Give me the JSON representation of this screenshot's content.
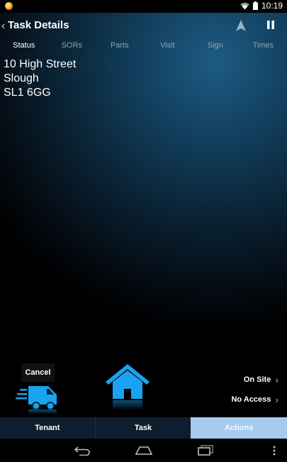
{
  "status_bar": {
    "time": "10:19"
  },
  "header": {
    "title": "Task Details"
  },
  "tabs": [
    {
      "label": "Status",
      "active": true
    },
    {
      "label": "SORs",
      "active": false
    },
    {
      "label": "Parts",
      "active": false
    },
    {
      "label": "Visit",
      "active": false
    },
    {
      "label": "Sign",
      "active": false
    },
    {
      "label": "Times",
      "active": false
    }
  ],
  "address": {
    "line1": "10 High Street",
    "line2": "Slough",
    "line3": "SL1 6GG"
  },
  "actions": {
    "cancel_tooltip": "Cancel",
    "on_site": "On Site",
    "no_access": "No Access"
  },
  "bottom_tabs": {
    "tenant": "Tenant",
    "task": "Task",
    "actions": "Actions"
  },
  "colors": {
    "accent": "#1aa3f0",
    "active_tab": "#a5ccec",
    "bottom_bar": "#0e1e2e"
  }
}
